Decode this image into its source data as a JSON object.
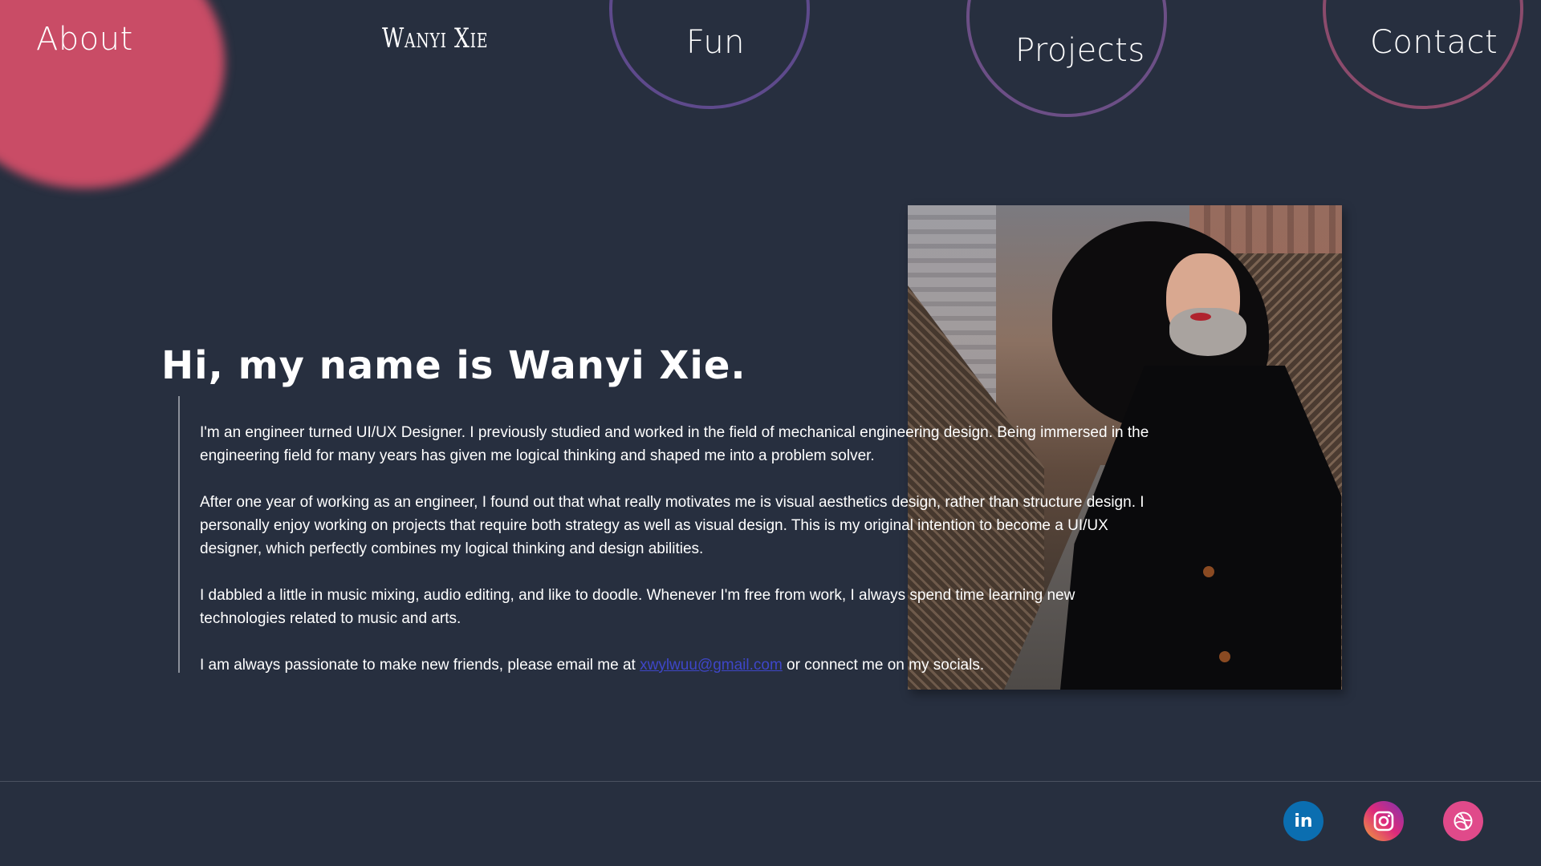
{
  "nav": {
    "about": "About",
    "brand": "Wanyi Xie",
    "fun": "Fun",
    "projects": "Projects",
    "contact": "Contact"
  },
  "intro": {
    "heading": "Hi, my name is Wanyi Xie.",
    "p1": "I'm an engineer turned UI/UX Designer. I previously studied and worked in the field of mechanical engineering design. Being immersed in the engineering field for many years has given me logical thinking and shaped me into a problem solver.",
    "p2": "After one year of working as an engineer, I found out that what really motivates me is visual aesthetics design, rather than structure design. I personally enjoy working on projects that require both strategy as well as visual design. This is my original intention to become a UI/UX designer, which perfectly combines my logical thinking and design abilities.",
    "p3": "I dabbled a little in music mixing, audio editing, and like to doodle. Whenever I'm free from work, I always spend time learning new technologies related to music and arts.",
    "p4_before": "I am always passionate to make new friends, please email me at ",
    "email": "xwylwuu@gmail.com",
    "p4_after": " or connect me on my socials."
  },
  "social": {
    "linkedin_icon": "linkedin-icon",
    "linkedin_text": "in",
    "instagram_icon": "instagram-icon",
    "dribbble_icon": "dribbble-icon"
  },
  "colors": {
    "background": "#272f3f",
    "accent_blob": "#c94c66",
    "ring_fun": "#5e4a8c",
    "ring_projects": "#6c4f86",
    "ring_contact": "#8b4b6c",
    "link": "#3e46c8",
    "linkedin": "#0b6eb0",
    "dribbble": "#e04a8a"
  }
}
